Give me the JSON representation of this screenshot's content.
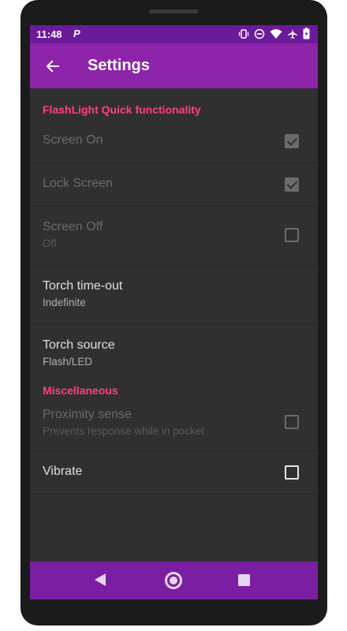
{
  "status_bar": {
    "time": "11:48",
    "app_badge": "P",
    "icons": [
      "vibrate-icon",
      "do-not-disturb-icon",
      "wifi-icon",
      "airplane-icon",
      "battery-icon"
    ]
  },
  "app_bar": {
    "title": "Settings",
    "back_icon": "arrow-back-icon"
  },
  "sections": {
    "flashlight": {
      "header": "FlashLight Quick functionality",
      "items": [
        {
          "title": "Screen On",
          "checked": true,
          "enabled": false
        },
        {
          "title": "Lock Screen",
          "checked": true,
          "enabled": false
        },
        {
          "title": "Screen Off",
          "summary": "Off",
          "checked": false,
          "enabled": false
        },
        {
          "title": "Torch time-out",
          "summary": "Indefinite",
          "enabled": true
        },
        {
          "title": "Torch source",
          "summary": "Flash/LED",
          "enabled": true
        }
      ]
    },
    "misc": {
      "header": "Miscellaneous",
      "items": [
        {
          "title": "Proximity sense",
          "summary": "Prevents response while in pocket",
          "checked": false,
          "enabled": false
        },
        {
          "title": "Vibrate",
          "checked": false,
          "enabled": true
        }
      ]
    }
  },
  "nav_bar": {
    "buttons": [
      "back-triangle-icon",
      "home-circle-icon",
      "recents-square-icon"
    ]
  },
  "colors": {
    "status_bar": "#6a1b9a",
    "app_bar": "#8e24aa",
    "nav_bar": "#7b1fa2",
    "background": "#303030",
    "accent": "#ff4081"
  }
}
